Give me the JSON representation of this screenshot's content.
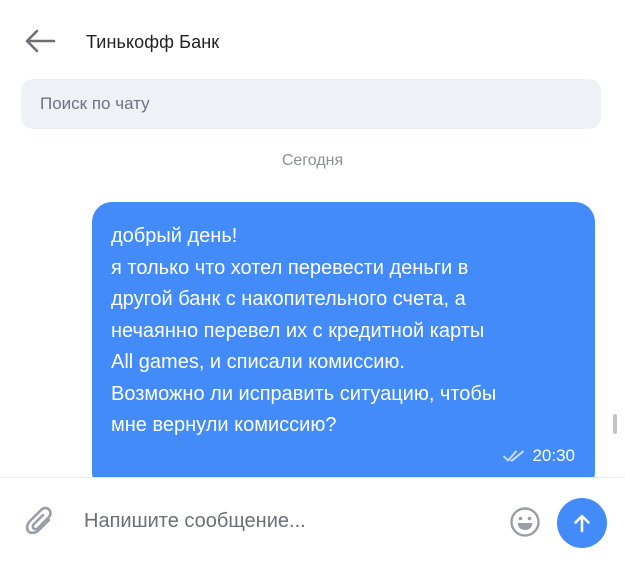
{
  "header": {
    "back_icon": "arrow-left-icon",
    "title": "Тинькофф Банк"
  },
  "search": {
    "placeholder": "Поиск по чату",
    "value": ""
  },
  "date_separator": "Сегодня",
  "messages": [
    {
      "direction": "outgoing",
      "lines": [
        "добрый день!",
        "я только что хотел перевести деньги в",
        "другой банк с накопительного счета, а",
        "нечаянно перевел их с кредитной карты",
        "All games, и списали комиссию.",
        "Возможно ли исправить ситуацию, чтобы",
        "мне вернули комиссию?"
      ],
      "time": "20:30",
      "status_icon": "double-check-icon",
      "bubble_color": "#428bf9"
    }
  ],
  "composer": {
    "attach_icon": "paperclip-icon",
    "placeholder": "Напишите сообщение...",
    "value": "",
    "emoji_icon": "smile-icon",
    "send_icon": "arrow-up-icon",
    "send_color": "#428bf9"
  }
}
